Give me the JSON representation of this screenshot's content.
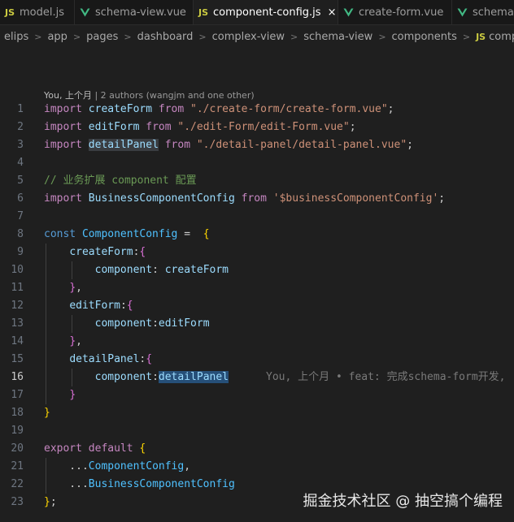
{
  "tabs": [
    {
      "icon": "JS",
      "label": "model.js",
      "active": false
    },
    {
      "icon": "vue",
      "label": "schema-view.vue",
      "active": false
    },
    {
      "icon": "JS",
      "label": "component-config.js",
      "active": true,
      "close": "×"
    },
    {
      "icon": "vue",
      "label": "create-form.vue",
      "active": false
    },
    {
      "icon": "vue",
      "label": "schema-view.vue",
      "active": false
    }
  ],
  "breadcrumb": [
    "elips",
    "app",
    "pages",
    "dashboard",
    "complex-view",
    "schema-view",
    "components",
    "component-config.js"
  ],
  "breadcrumb_file_icon": "JS",
  "blame_header": {
    "author": "You, 上个月",
    "authors": "| 2 authors (wangjm and one other)"
  },
  "code_lines": [
    {
      "n": "1",
      "t": [
        [
          "kw2",
          "import "
        ],
        [
          "var",
          "createForm "
        ],
        [
          "kw2",
          "from "
        ],
        [
          "str",
          "\"./create-form/create-form.vue\""
        ],
        [
          "punc",
          ";"
        ]
      ]
    },
    {
      "n": "2",
      "t": [
        [
          "kw2",
          "import "
        ],
        [
          "var",
          "editForm "
        ],
        [
          "kw2",
          "from "
        ],
        [
          "str",
          "\"./edit-Form/edit-Form.vue\""
        ],
        [
          "punc",
          ";"
        ]
      ]
    },
    {
      "n": "3",
      "t": [
        [
          "kw2",
          "import "
        ],
        [
          "var hl",
          "detailPanel"
        ],
        [
          "var",
          " "
        ],
        [
          "kw2",
          "from "
        ],
        [
          "str",
          "\"./detail-panel/detail-panel.vue\""
        ],
        [
          "punc",
          ";"
        ]
      ]
    },
    {
      "n": "4",
      "t": []
    },
    {
      "n": "5",
      "t": [
        [
          "cmt",
          "// 业务扩展 component 配置"
        ]
      ]
    },
    {
      "n": "6",
      "t": [
        [
          "kw2",
          "import "
        ],
        [
          "var",
          "BusinessComponentConfig "
        ],
        [
          "kw2",
          "from "
        ],
        [
          "str",
          "'$businessComponentConfig'"
        ],
        [
          "punc",
          ";"
        ]
      ]
    },
    {
      "n": "7",
      "t": []
    },
    {
      "n": "8",
      "t": [
        [
          "kw",
          "const "
        ],
        [
          "cst",
          "ComponentConfig "
        ],
        [
          "punc",
          "=  "
        ],
        [
          "br1",
          "{"
        ]
      ]
    },
    {
      "n": "9",
      "t": [
        [
          "punc",
          "    "
        ],
        [
          "prop",
          "createForm"
        ],
        [
          "punc",
          ":"
        ],
        [
          "br2",
          "{"
        ]
      ]
    },
    {
      "n": "10",
      "t": [
        [
          "punc",
          "        "
        ],
        [
          "prop",
          "component"
        ],
        [
          "punc",
          ": "
        ],
        [
          "var",
          "createForm"
        ]
      ]
    },
    {
      "n": "11",
      "t": [
        [
          "punc",
          "    "
        ],
        [
          "br2",
          "}"
        ],
        [
          "punc",
          ","
        ]
      ]
    },
    {
      "n": "12",
      "t": [
        [
          "punc",
          "    "
        ],
        [
          "prop",
          "editForm"
        ],
        [
          "punc",
          ":"
        ],
        [
          "br2",
          "{"
        ]
      ]
    },
    {
      "n": "13",
      "t": [
        [
          "punc",
          "        "
        ],
        [
          "prop",
          "component"
        ],
        [
          "punc",
          ":"
        ],
        [
          "var",
          "editForm"
        ]
      ]
    },
    {
      "n": "14",
      "t": [
        [
          "punc",
          "    "
        ],
        [
          "br2",
          "}"
        ],
        [
          "punc",
          ","
        ]
      ]
    },
    {
      "n": "15",
      "t": [
        [
          "punc",
          "    "
        ],
        [
          "prop",
          "detailPanel"
        ],
        [
          "punc",
          ":"
        ],
        [
          "br2",
          "{"
        ]
      ]
    },
    {
      "n": "16",
      "t": [
        [
          "punc",
          "        "
        ],
        [
          "prop",
          "component"
        ],
        [
          "punc",
          ":"
        ],
        [
          "var hl2",
          "detailPanel"
        ]
      ],
      "blame": "You, 上个月 • feat: 完成schema-form开发,"
    },
    {
      "n": "17",
      "t": [
        [
          "punc",
          "    "
        ],
        [
          "br2",
          "}"
        ]
      ]
    },
    {
      "n": "18",
      "t": [
        [
          "br1",
          "}"
        ]
      ]
    },
    {
      "n": "19",
      "t": []
    },
    {
      "n": "20",
      "t": [
        [
          "kw2",
          "export "
        ],
        [
          "kw2",
          "default "
        ],
        [
          "br1",
          "{"
        ]
      ]
    },
    {
      "n": "21",
      "t": [
        [
          "punc",
          "    ..."
        ],
        [
          "cst",
          "ComponentConfig"
        ],
        [
          "punc",
          ","
        ]
      ]
    },
    {
      "n": "22",
      "t": [
        [
          "punc",
          "    ..."
        ],
        [
          "cst",
          "BusinessComponentConfig"
        ]
      ]
    },
    {
      "n": "23",
      "t": [
        [
          "br1",
          "}"
        ],
        [
          "punc",
          ";"
        ]
      ]
    }
  ],
  "current_line": "16",
  "watermark": "掘金技术社区 @ 抽空搞个编程",
  "colors": {
    "background": "#1f1f1f",
    "tabbar": "#181818",
    "keyword_control": "#c586c0",
    "keyword": "#569cd6",
    "variable": "#9cdcfe",
    "constant": "#4fc1ff",
    "string": "#ce9178",
    "comment": "#6a9955",
    "bracket_level1": "#ffd700",
    "bracket_level2": "#da70d6",
    "js_icon": "#cbcb41",
    "vue_icon": "#41b883"
  }
}
